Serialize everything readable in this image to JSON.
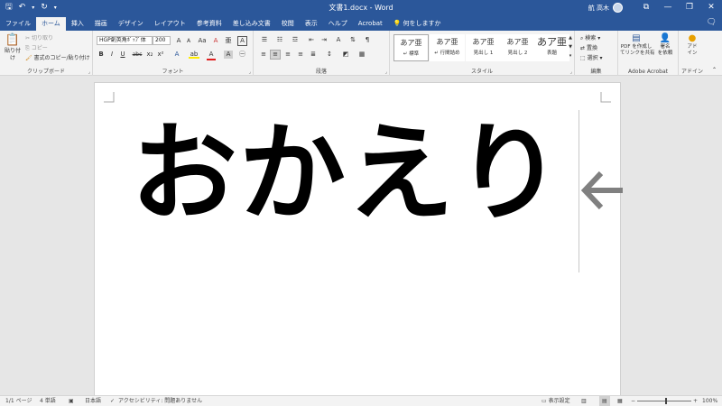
{
  "titlebar": {
    "save_icon": "save-icon",
    "undo_icon": "undo-icon",
    "redo_icon": "redo-icon",
    "customize_icon": "customize-icon",
    "document_title": "文書1.docx  -  Word",
    "user_name": "航 高木",
    "ribbon_display_icon": "ribbon-display-icon",
    "minimize_label": "—",
    "restore_label": "❐",
    "close_label": "✕"
  },
  "tabs": [
    {
      "label": "ファイル"
    },
    {
      "label": "ホーム"
    },
    {
      "label": "挿入"
    },
    {
      "label": "描画"
    },
    {
      "label": "デザイン"
    },
    {
      "label": "レイアウト"
    },
    {
      "label": "参考資料"
    },
    {
      "label": "差し込み文書"
    },
    {
      "label": "校閲"
    },
    {
      "label": "表示"
    },
    {
      "label": "ヘルプ"
    },
    {
      "label": "Acrobat"
    }
  ],
  "tell_me": "何をしますか",
  "clipboard": {
    "paste": "貼り付け",
    "cut": "切り取り",
    "copy": "コピー",
    "format_painter": "書式のコピー/貼り付け",
    "group_label": "クリップボード"
  },
  "font": {
    "font_name": "HGP創英角ﾎﾟｯﾌﾟ体",
    "font_size": "200",
    "grow": "A",
    "shrink": "A",
    "case": "Aa",
    "clear": "A",
    "bold": "B",
    "italic": "I",
    "underline": "U",
    "strike": "abc",
    "subscript": "x₂",
    "superscript": "x²",
    "effects": "A",
    "highlight": "ab",
    "color": "A",
    "charshade": "A",
    "charborder": "A",
    "group_label": "フォント"
  },
  "paragraph": {
    "group_label": "段落"
  },
  "styles": {
    "items": [
      {
        "sample": "あア亜",
        "name": "標準"
      },
      {
        "sample": "あア亜",
        "name": "行間詰め"
      },
      {
        "sample": "あア亜",
        "name": "見出し 1"
      },
      {
        "sample": "あア亜",
        "name": "見出し 2"
      },
      {
        "sample": "あア亜",
        "name": "表題"
      }
    ],
    "group_label": "スタイル"
  },
  "editing": {
    "find": "検索",
    "replace": "置換",
    "select": "選択",
    "group_label": "編集"
  },
  "acrobat": {
    "create_pdf": "PDF を作成し\nてリンクを共有",
    "request_sign": "署名\nを依頼",
    "group_label": "Adobe Acrobat"
  },
  "addins": {
    "label": "アド\nイン",
    "group_label": "アドイン"
  },
  "document": {
    "text": "おかえり",
    "arrow": "←"
  },
  "status": {
    "page": "1/1 ページ",
    "words": "4 単語",
    "language": "日本語",
    "accessibility": "アクセシビリティ: 問題ありません",
    "display_settings": "表示設定",
    "zoom_minus": "−",
    "zoom_plus": "+",
    "zoom": "100%"
  }
}
